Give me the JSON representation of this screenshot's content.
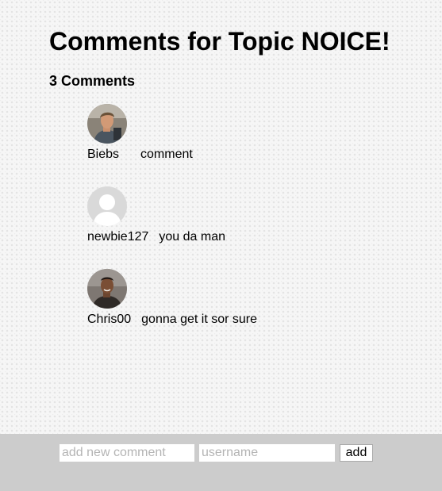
{
  "page": {
    "title": "Comments for Topic NOICE!",
    "comment_count_label": "3 Comments"
  },
  "comments": [
    {
      "username": "Biebs",
      "text": "comment",
      "avatar": "user-photo-avatar"
    },
    {
      "username": "newbie127",
      "text": "you da man",
      "avatar": "default-user-avatar"
    },
    {
      "username": "Chris00",
      "text": "gonna get it sor sure",
      "avatar": "user-photo-avatar"
    }
  ],
  "form": {
    "comment_placeholder": "add new comment",
    "username_placeholder": "username",
    "add_label": "add"
  }
}
